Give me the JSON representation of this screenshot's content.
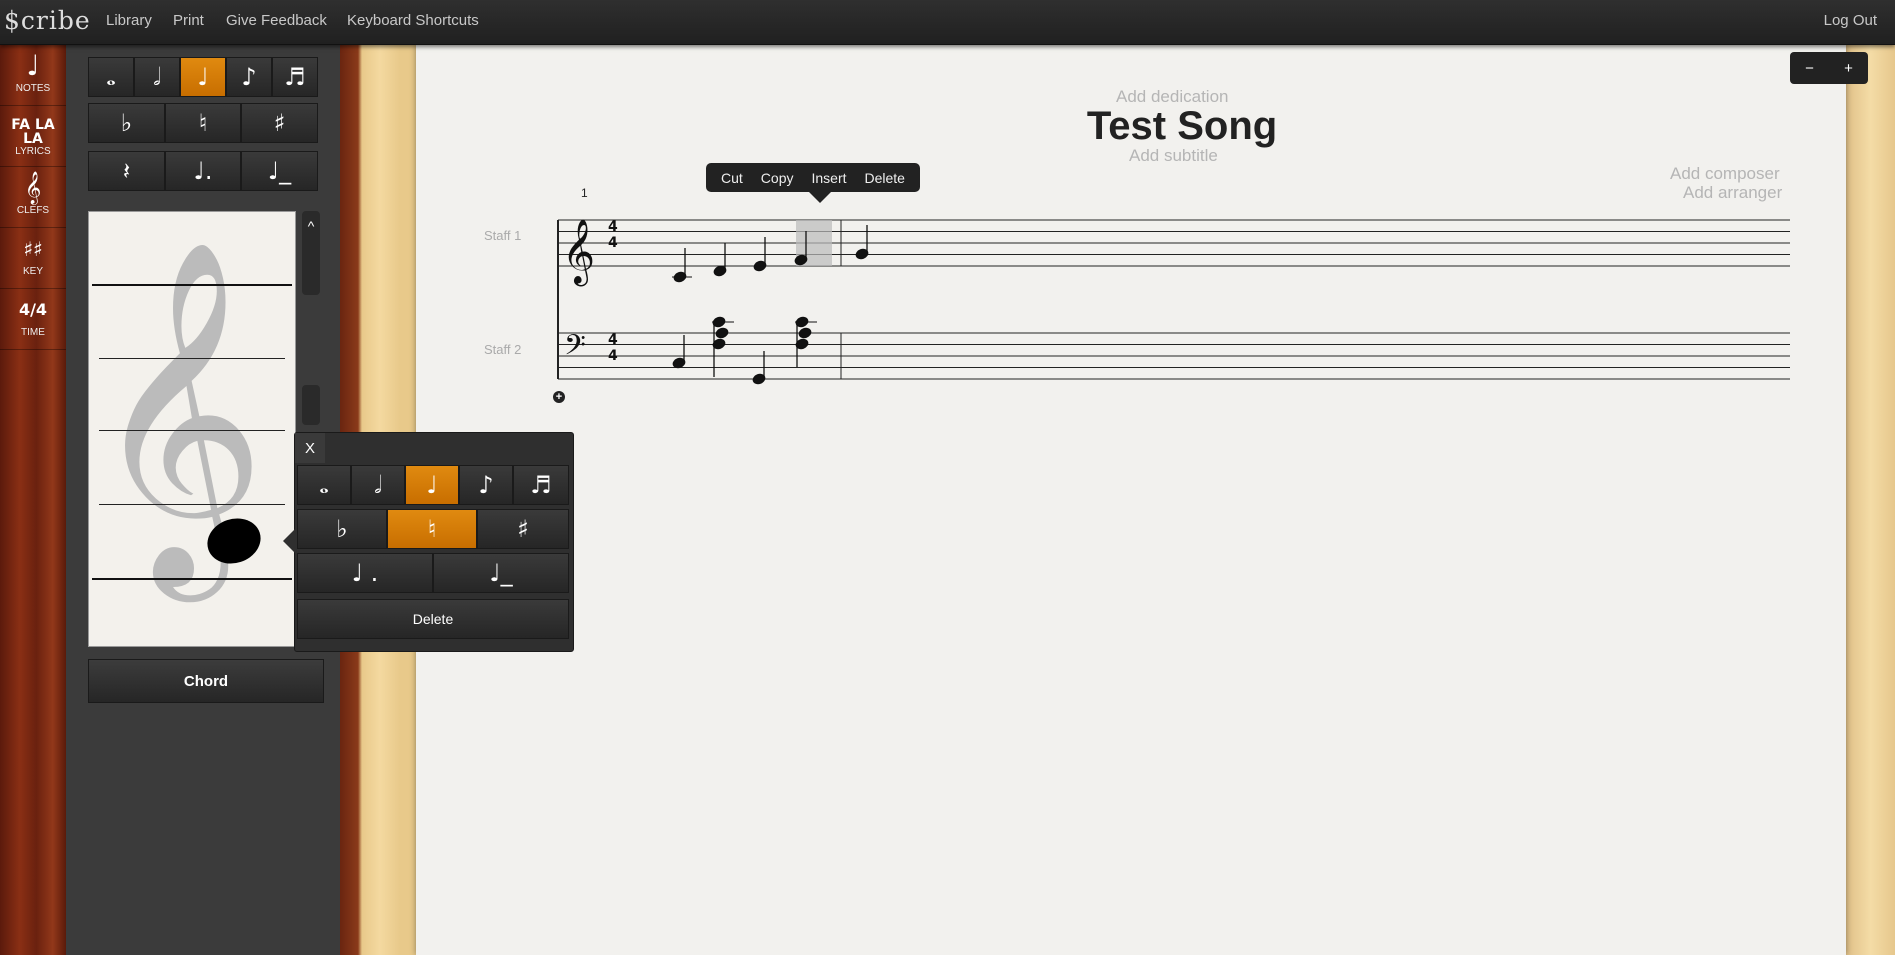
{
  "app": {
    "logo": "$cribe",
    "nav": [
      "Library",
      "Print",
      "Give Feedback",
      "Keyboard Shortcuts"
    ],
    "logout": "Log Out"
  },
  "tools": [
    {
      "icon": "quarter-note-icon",
      "glyph": "♩",
      "label": "NOTES"
    },
    {
      "icon": "lyrics-icon",
      "glyph": "FA LA LA",
      "label": "LYRICS"
    },
    {
      "icon": "treble-clef-icon",
      "glyph": "𝄞",
      "label": "CLEFS"
    },
    {
      "icon": "key-signature-icon",
      "glyph": "♯♯",
      "label": "KEY"
    },
    {
      "icon": "time-signature-icon",
      "glyph": "4/4",
      "label": "TIME"
    }
  ],
  "palette": {
    "close": "×",
    "durations": [
      {
        "icon": "whole-note-icon",
        "glyph": "𝅝",
        "selected": false
      },
      {
        "icon": "half-note-icon",
        "glyph": "𝅗𝅥",
        "selected": false
      },
      {
        "icon": "quarter-note-icon",
        "glyph": "♩",
        "selected": true
      },
      {
        "icon": "eighth-note-icon",
        "glyph": "♪",
        "selected": false
      },
      {
        "icon": "sixteenth-note-icon",
        "glyph": "♬",
        "selected": false
      }
    ],
    "accidentals": [
      {
        "icon": "flat-icon",
        "glyph": "♭"
      },
      {
        "icon": "natural-icon",
        "glyph": "♮"
      },
      {
        "icon": "sharp-icon",
        "glyph": "♯"
      }
    ],
    "modifiers": [
      {
        "icon": "quarter-rest-icon",
        "glyph": "𝄽"
      },
      {
        "icon": "dotted-note-icon",
        "glyph": "♩."
      },
      {
        "icon": "tied-note-icon",
        "glyph": "♩_"
      }
    ],
    "scroll_up": "^",
    "chord_label": "Chord"
  },
  "score": {
    "dedication_placeholder": "Add dedication",
    "title": "Test Song",
    "subtitle_placeholder": "Add subtitle",
    "composer_placeholder": "Add composer",
    "arranger_placeholder": "Add arranger",
    "measure_number": "1",
    "staves": [
      {
        "label": "Staff 1",
        "clef": "treble",
        "time": [
          "4",
          "4"
        ]
      },
      {
        "label": "Staff 2",
        "clef": "bass",
        "time": [
          "4",
          "4"
        ]
      }
    ],
    "add_staff": "+"
  },
  "context_menu": [
    "Cut",
    "Copy",
    "Insert",
    "Delete"
  ],
  "note_popup": {
    "close": "X",
    "durations": [
      {
        "icon": "whole-note-icon",
        "glyph": "𝅝",
        "selected": false
      },
      {
        "icon": "half-note-icon",
        "glyph": "𝅗𝅥",
        "selected": false
      },
      {
        "icon": "quarter-note-icon",
        "glyph": "♩",
        "selected": true
      },
      {
        "icon": "eighth-note-icon",
        "glyph": "♪",
        "selected": false
      },
      {
        "icon": "sixteenth-note-icon",
        "glyph": "♬",
        "selected": false
      }
    ],
    "accidentals": [
      {
        "icon": "flat-icon",
        "glyph": "♭",
        "selected": false
      },
      {
        "icon": "natural-icon",
        "glyph": "♮",
        "selected": true
      },
      {
        "icon": "sharp-icon",
        "glyph": "♯",
        "selected": false
      }
    ],
    "modifiers": [
      {
        "icon": "dotted-note-icon",
        "glyph": "♩ ."
      },
      {
        "icon": "tied-note-icon",
        "glyph": "♩_"
      }
    ],
    "delete": "Delete"
  },
  "zoom": [
    {
      "icon": "zoom-out-icon",
      "glyph": "−"
    },
    {
      "icon": "zoom-in-icon",
      "glyph": "+"
    }
  ],
  "colors": {
    "accent": "#d97c06",
    "topbar": "#262626",
    "paper": "#f2f1ee"
  }
}
